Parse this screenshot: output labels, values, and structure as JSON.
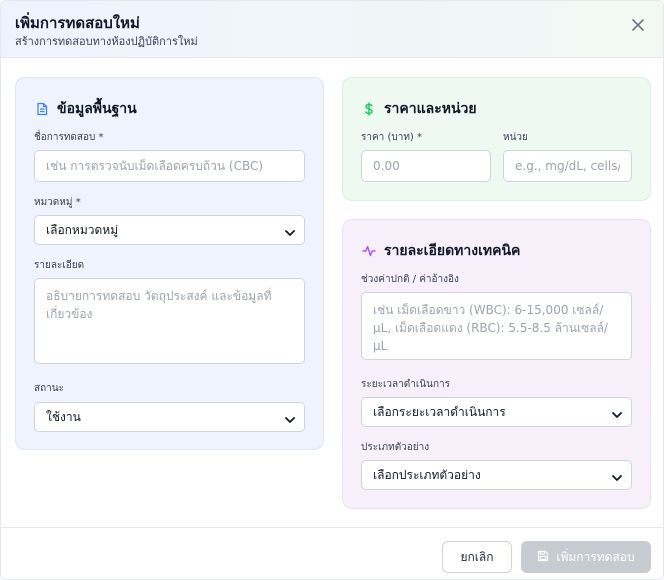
{
  "header": {
    "title": "เพิ่มการทดสอบใหม่",
    "subtitle": "สร้างการทดสอบทางห้องปฏิบัติการใหม่"
  },
  "basic": {
    "title": "ข้อมูลพื้นฐาน",
    "name_label": "ชื่อการทดสอบ *",
    "name_placeholder": "เช่น การตรวจนับเม็ดเลือดครบถ้วน (CBC)",
    "category_label": "หมวดหมู่ *",
    "category_value": "เลือกหมวดหมู่",
    "description_label": "รายละเอียด",
    "description_placeholder": "อธิบายการทดสอบ วัตถุประสงค์ และข้อมูลที่เกี่ยวข้อง",
    "status_label": "สถานะ",
    "status_value": "ใช้งาน"
  },
  "price": {
    "title": "ราคาและหน่วย",
    "price_label": "ราคา (บาท) *",
    "price_placeholder": "0.00",
    "unit_label": "หน่วย",
    "unit_placeholder": "e.g., mg/dL, cells/µL"
  },
  "tech": {
    "title": "รายละเอียดทางเทคนิค",
    "range_label": "ช่วงค่าปกติ / ค่าอ้างอิง",
    "range_placeholder": "เช่น เม็ดเลือดขาว (WBC): 6-15,000 เซลล์/µL, เม็ดเลือดแดง (RBC): 5.5-8.5 ล้านเซลล์/µL",
    "duration_label": "ระยะเวลาดำเนินการ",
    "duration_value": "เลือกระยะเวลาดำเนินการ",
    "sample_label": "ประเภทตัวอย่าง",
    "sample_value": "เลือกประเภทตัวอย่าง"
  },
  "footer": {
    "cancel_label": "ยกเลิก",
    "submit_label": "เพิ่มการทดสอบ"
  },
  "colors": {
    "basic_icon": "#3b82f6",
    "price_icon": "#22c55e",
    "tech_icon": "#a855f7",
    "submit_disabled": "#c7cbd2"
  },
  "icons": {
    "basic": "document-icon",
    "price": "dollar-icon",
    "tech": "activity-icon",
    "close": "close-icon",
    "submit": "save-icon"
  }
}
